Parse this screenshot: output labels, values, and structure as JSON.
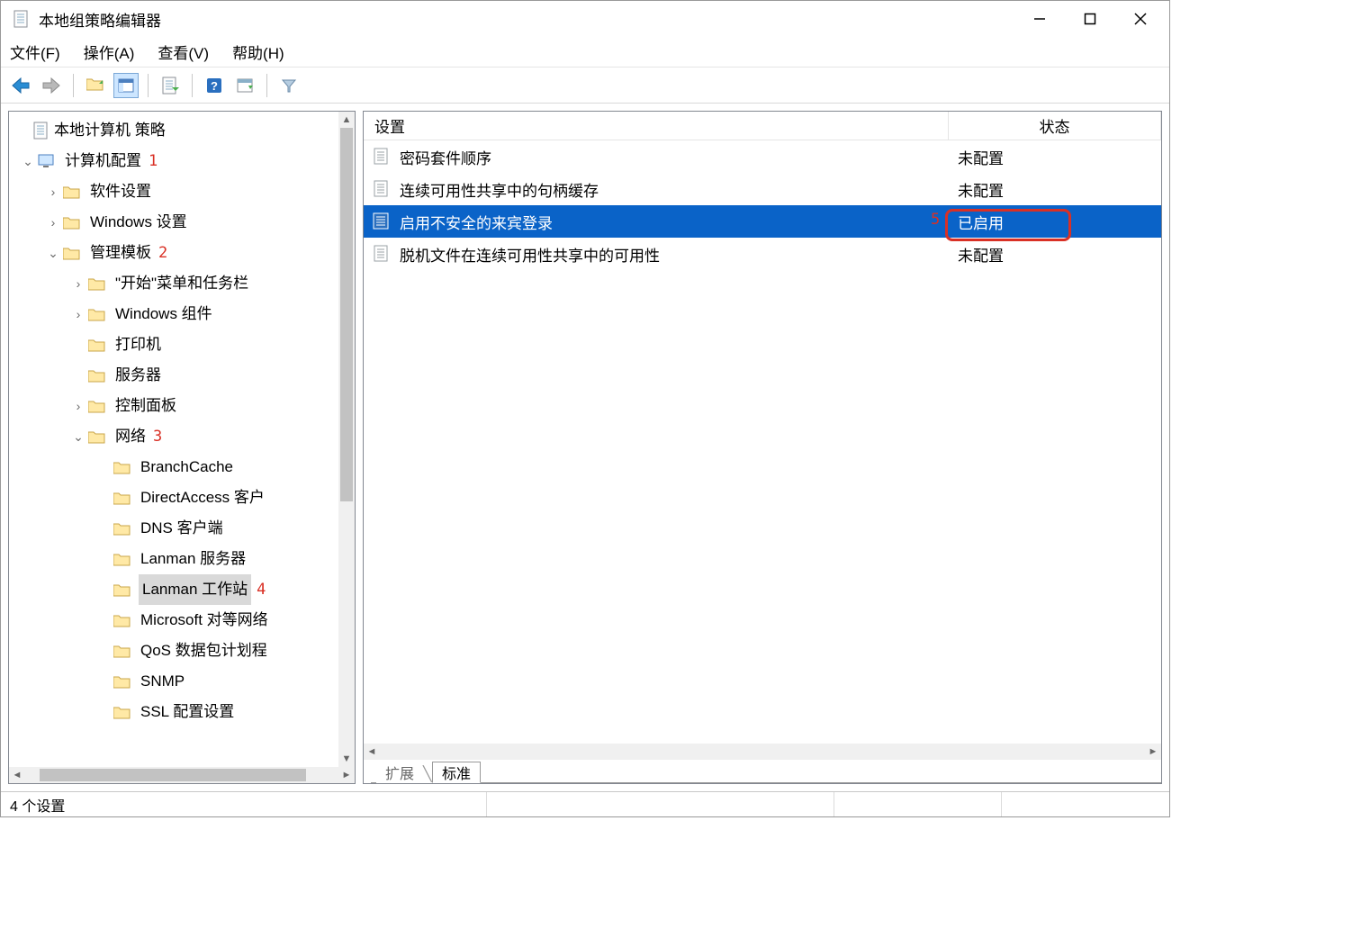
{
  "window": {
    "title": "本地组策略编辑器"
  },
  "menu": {
    "file": "文件(F)",
    "action": "操作(A)",
    "view": "查看(V)",
    "help": "帮助(H)"
  },
  "tree": {
    "root": "本地计算机 策略",
    "computer_config": "计算机配置",
    "software_settings": "软件设置",
    "windows_settings": "Windows 设置",
    "admin_templates": "管理模板",
    "start_menu": "\"开始\"菜单和任务栏",
    "windows_components": "Windows 组件",
    "printers": "打印机",
    "servers": "服务器",
    "control_panel": "控制面板",
    "network": "网络",
    "branchcache": "BranchCache",
    "directaccess": "DirectAccess 客户",
    "dns_client": "DNS 客户端",
    "lanman_server": "Lanman 服务器",
    "lanman_workstation": "Lanman 工作站",
    "ms_p2p": "Microsoft 对等网络",
    "qos": "QoS 数据包计划程",
    "snmp": "SNMP",
    "ssl": "SSL 配置设置"
  },
  "annotations": {
    "a1": "1",
    "a2": "2",
    "a3": "3",
    "a4": "4",
    "a5": "5"
  },
  "list": {
    "header": {
      "setting": "设置",
      "state": "状态"
    },
    "rows": [
      {
        "setting": "密码套件顺序",
        "state": "未配置"
      },
      {
        "setting": "连续可用性共享中的句柄缓存",
        "state": "未配置"
      },
      {
        "setting": "启用不安全的来宾登录",
        "state": "已启用"
      },
      {
        "setting": "脱机文件在连续可用性共享中的可用性",
        "state": "未配置"
      }
    ]
  },
  "tabs": {
    "extended": "扩展",
    "standard": "标准"
  },
  "status": {
    "count": "4 个设置"
  }
}
